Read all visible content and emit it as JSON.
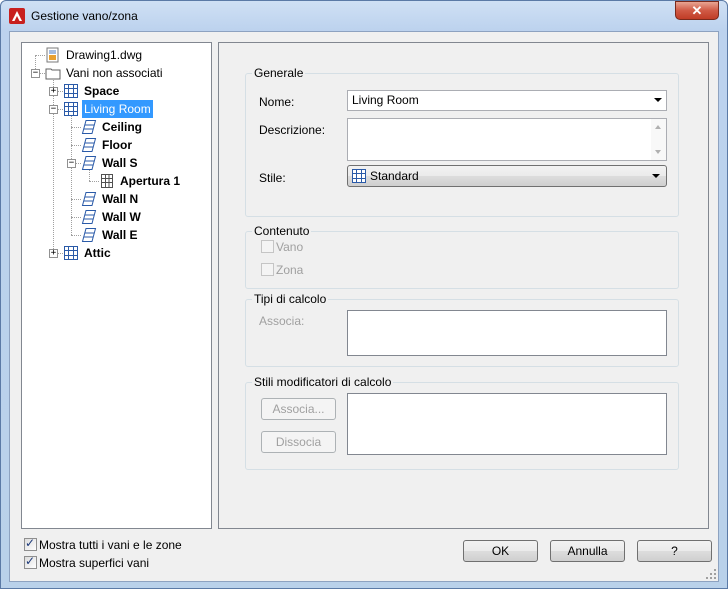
{
  "window": {
    "title": "Gestione vano/zona",
    "close_label": "✕"
  },
  "tree": {
    "items": [
      {
        "label": "Drawing1.dwg",
        "icon": "dwg-file-icon",
        "bold": false
      },
      {
        "label": "Vani non associati",
        "icon": "folder-icon",
        "bold": false
      },
      {
        "label": "Space",
        "icon": "space-icon",
        "bold": true
      },
      {
        "label": "Living Room",
        "icon": "space-icon",
        "bold": false,
        "selected": true
      },
      {
        "label": "Ceiling",
        "icon": "surface-icon",
        "bold": true
      },
      {
        "label": "Floor",
        "icon": "surface-icon",
        "bold": true
      },
      {
        "label": "Wall S",
        "icon": "surface-icon",
        "bold": true
      },
      {
        "label": "Apertura 1",
        "icon": "opening-icon",
        "bold": true
      },
      {
        "label": "Wall N",
        "icon": "surface-icon",
        "bold": true
      },
      {
        "label": "Wall W",
        "icon": "surface-icon",
        "bold": true
      },
      {
        "label": "Wall E",
        "icon": "surface-icon",
        "bold": true
      },
      {
        "label": "Attic",
        "icon": "space-icon",
        "bold": true
      }
    ]
  },
  "generale": {
    "title": "Generale",
    "nome_label": "Nome:",
    "nome_value": "Living Room",
    "descrizione_label": "Descrizione:",
    "stile_label": "Stile:",
    "stile_value": "Standard"
  },
  "contenuto": {
    "title": "Contenuto",
    "vano_label": "Vano",
    "zona_label": "Zona"
  },
  "tipi_calcolo": {
    "title": "Tipi di calcolo",
    "associa_label": "Associa:"
  },
  "stili_modificatori": {
    "title": "Stili modificatori di calcolo",
    "associa_button": "Associa...",
    "dissocia_button": "Dissocia"
  },
  "footer": {
    "mostra_tutti": "Mostra tutti i vani e le zone",
    "mostra_superfici": "Mostra superfici vani",
    "ok": "OK",
    "annulla": "Annulla",
    "help": "?"
  },
  "colors": {
    "selection": "#3399ff",
    "close": "#c03c26"
  }
}
